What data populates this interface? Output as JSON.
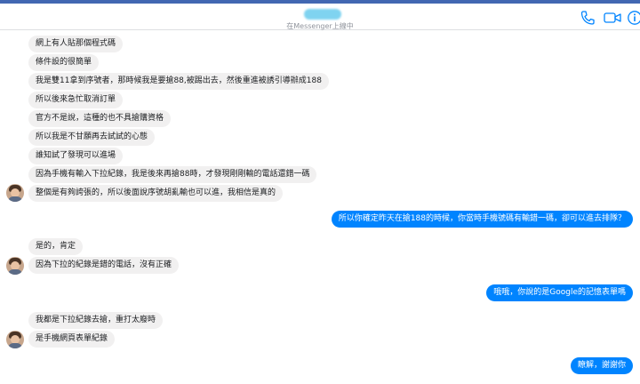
{
  "header": {
    "presence_text": "在Messenger上線中",
    "icons": [
      "phone-icon",
      "video-camera-icon",
      "info-icon"
    ],
    "accent_color": "#0084ff"
  },
  "conversation": {
    "incoming_group_1": [
      "網上有人貼那個程式碼",
      "條件設的很簡單",
      "我是雙11拿到序號者，那時候我是要搶88,被踢出去，然後重進被誘引導辦成188",
      "所以後來急忙取消訂單",
      "官方不是說，這種的也不具搶購資格",
      "所以我是不甘願再去試試的心態",
      "誰知試了發現可以進場",
      "因為手機有輸入下拉紀錄，我是後來再搶88時，才發現剛剛輸的電話還錯一碼",
      "整個是有夠誇張的，所以後面說序號胡亂輸也可以進，我相信是真的"
    ],
    "outgoing_1": "所以你確定昨天在搶188的時候，你當時手機號碼有輸錯一碼，卻可以進去排隊？",
    "incoming_group_2": [
      "是的，肯定",
      "因為下拉的紀錄是錯的電話，沒有正確"
    ],
    "outgoing_2": "哦哦，你說的是Google的記憶表單嗎",
    "incoming_group_3": [
      "我都是下拉紀錄去搶，重打太廢時",
      "是手機網頁表單紀錄"
    ],
    "outgoing_3": "瞭解，謝謝你"
  }
}
